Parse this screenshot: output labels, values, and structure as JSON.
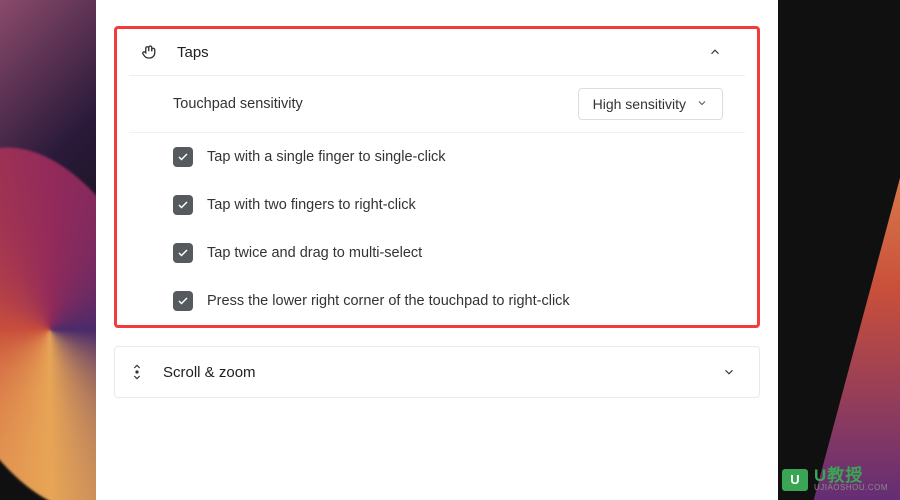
{
  "sections": {
    "taps": {
      "title": "Taps",
      "sensitivity_label": "Touchpad sensitivity",
      "sensitivity_value": "High sensitivity",
      "options": [
        {
          "label": "Tap with a single finger to single-click",
          "checked": true
        },
        {
          "label": "Tap with two fingers to right-click",
          "checked": true
        },
        {
          "label": "Tap twice and drag to multi-select",
          "checked": true
        },
        {
          "label": "Press the lower right corner of the touchpad to right-click",
          "checked": true
        }
      ]
    },
    "scroll_zoom": {
      "title": "Scroll & zoom"
    }
  },
  "watermark": {
    "main": "U教授",
    "sub": "UJIAOSHOU.COM"
  }
}
